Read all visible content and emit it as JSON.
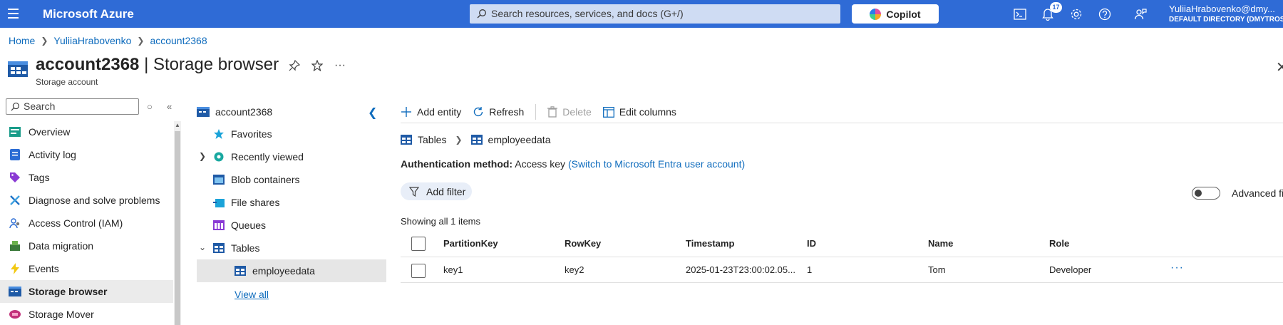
{
  "topbar": {
    "brand": "Microsoft Azure",
    "search_placeholder": "Search resources, services, and docs (G+/)",
    "copilot_label": "Copilot",
    "notifications_count": "17",
    "user_name": "YuliiaHrabovenko@dmy...",
    "directory": "DEFAULT DIRECTORY (DMYTROS..."
  },
  "breadcrumb": [
    "Home",
    "YuliiaHrabovenko",
    "account2368"
  ],
  "title": {
    "resource": "account2368",
    "separator": " | ",
    "page": "Storage browser",
    "subtitle": "Storage account"
  },
  "nav": {
    "search_placeholder": "Search",
    "items": [
      {
        "label": "Overview",
        "icon": "overview-icon"
      },
      {
        "label": "Activity log",
        "icon": "activity-log-icon"
      },
      {
        "label": "Tags",
        "icon": "tag-icon"
      },
      {
        "label": "Diagnose and solve problems",
        "icon": "wrench-icon"
      },
      {
        "label": "Access Control (IAM)",
        "icon": "people-icon"
      },
      {
        "label": "Data migration",
        "icon": "migration-icon"
      },
      {
        "label": "Events",
        "icon": "lightning-icon"
      },
      {
        "label": "Storage browser",
        "icon": "storage-browser-icon",
        "selected": true
      },
      {
        "label": "Storage Mover",
        "icon": "storage-mover-icon"
      }
    ]
  },
  "tree": {
    "root": "account2368",
    "items": [
      {
        "label": "Favorites"
      },
      {
        "label": "Recently viewed"
      },
      {
        "label": "Blob containers"
      },
      {
        "label": "File shares"
      },
      {
        "label": "Queues"
      },
      {
        "label": "Tables"
      },
      {
        "label": "employeedata"
      }
    ],
    "view_all": "View all"
  },
  "toolbar": {
    "add_entity": "Add entity",
    "refresh": "Refresh",
    "delete": "Delete",
    "edit_columns": "Edit columns"
  },
  "path": {
    "tables": "Tables",
    "table": "employeedata"
  },
  "auth": {
    "label": "Authentication method:",
    "value": "Access key",
    "switch_link": "(Switch to Microsoft Entra user account)"
  },
  "filter": {
    "add_filter": "Add filter",
    "advanced": "Advanced filter"
  },
  "grid": {
    "showing": "Showing all 1 items",
    "columns": [
      "PartitionKey",
      "RowKey",
      "Timestamp",
      "ID",
      "Name",
      "Role"
    ],
    "rows": [
      [
        "key1",
        "key2",
        "2025-01-23T23:00:02.05...",
        "1",
        "Tom",
        "Developer"
      ]
    ]
  },
  "colors": {
    "topbar": "#2f6bd6",
    "link": "#0f6cbd",
    "selected_bg": "#ebebeb"
  }
}
